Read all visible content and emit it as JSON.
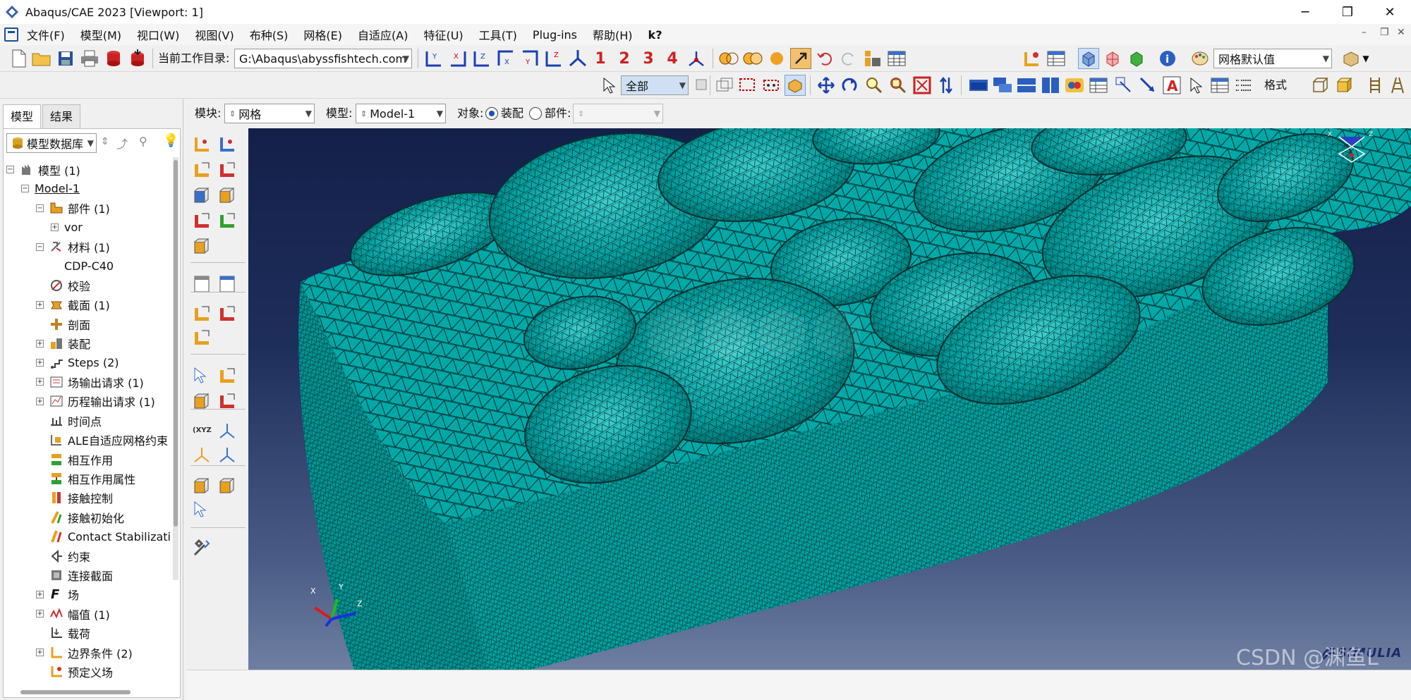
{
  "window": {
    "title": "Abaqus/CAE 2023 [Viewport: 1]",
    "min": "─",
    "max": "❐",
    "close": "✕"
  },
  "menubar": {
    "items": [
      "文件(F)",
      "模型(M)",
      "视口(W)",
      "视图(V)",
      "布种(S)",
      "网格(E)",
      "自适应(A)",
      "特征(U)",
      "工具(T)",
      "Plug-ins",
      "帮助(H)",
      "k?"
    ],
    "mdi": [
      "–",
      "❐",
      "✕"
    ]
  },
  "toolbar1": {
    "workdir_label": "当前工作目录:",
    "workdir_value": "G:\\Abaqus\\abyssfishtech.com",
    "views": [
      "1",
      "2",
      "3",
      "4"
    ],
    "render_style": "网格默认值"
  },
  "toolbar2": {
    "selection_filter": "全部",
    "format_label": "格式"
  },
  "context": {
    "module_label": "模块:",
    "module_value": "网格",
    "model_label": "模型:",
    "model_value": "Model-1",
    "object_label": "对象:",
    "assembly_label": "装配",
    "part_label": "部件:",
    "part_value": ""
  },
  "tabs": [
    "模型",
    "结果"
  ],
  "tree_combo": "模型数据库",
  "tree": [
    {
      "label": "模型 (1)",
      "level": 0,
      "exp": "⊟",
      "icon": "models-icon"
    },
    {
      "label": "Model-1",
      "level": 1,
      "exp": "⊟",
      "icon": ""
    },
    {
      "label": "部件 (1)",
      "level": 2,
      "exp": "⊟",
      "icon": "parts-icon"
    },
    {
      "label": "vor",
      "level": 3,
      "exp": "⊞",
      "icon": ""
    },
    {
      "label": "材料 (1)",
      "level": 2,
      "exp": "⊟",
      "icon": "materials-icon"
    },
    {
      "label": "CDP-C40",
      "level": 3,
      "exp": "",
      "icon": ""
    },
    {
      "label": "校验",
      "level": 2,
      "exp": "",
      "icon": "calibration-icon"
    },
    {
      "label": "截面 (1)",
      "level": 2,
      "exp": "⊞",
      "icon": "sections-icon"
    },
    {
      "label": "剖面",
      "level": 2,
      "exp": "",
      "icon": "profiles-icon"
    },
    {
      "label": "装配",
      "level": 2,
      "exp": "⊞",
      "icon": "assembly-icon"
    },
    {
      "label": "Steps (2)",
      "level": 2,
      "exp": "⊞",
      "icon": "steps-icon"
    },
    {
      "label": "场输出请求 (1)",
      "level": 2,
      "exp": "⊞",
      "icon": "field-output-icon"
    },
    {
      "label": "历程输出请求 (1)",
      "level": 2,
      "exp": "⊞",
      "icon": "history-output-icon"
    },
    {
      "label": "时间点",
      "level": 2,
      "exp": "",
      "icon": "time-points-icon"
    },
    {
      "label": "ALE自适应网格约束",
      "level": 2,
      "exp": "",
      "icon": "ale-icon"
    },
    {
      "label": "相互作用",
      "level": 2,
      "exp": "",
      "icon": "interaction-icon"
    },
    {
      "label": "相互作用属性",
      "level": 2,
      "exp": "",
      "icon": "interaction-property-icon"
    },
    {
      "label": "接触控制",
      "level": 2,
      "exp": "",
      "icon": "contact-control-icon"
    },
    {
      "label": "接触初始化",
      "level": 2,
      "exp": "",
      "icon": "contact-init-icon"
    },
    {
      "label": "Contact Stabilizati",
      "level": 2,
      "exp": "",
      "icon": "contact-stabilization-icon"
    },
    {
      "label": "约束",
      "level": 2,
      "exp": "",
      "icon": "constraint-icon"
    },
    {
      "label": "连接截面",
      "level": 2,
      "exp": "",
      "icon": "connector-section-icon"
    },
    {
      "label": "场",
      "level": 2,
      "exp": "⊞",
      "icon": "field-icon"
    },
    {
      "label": "幅值 (1)",
      "level": 2,
      "exp": "⊞",
      "icon": "amplitude-icon"
    },
    {
      "label": "载荷",
      "level": 2,
      "exp": "",
      "icon": "load-icon"
    },
    {
      "label": "边界条件 (2)",
      "level": 2,
      "exp": "⊞",
      "icon": "bc-icon"
    },
    {
      "label": "预定义场",
      "level": 2,
      "exp": "",
      "icon": "predefined-field-icon"
    }
  ],
  "viewport": {
    "triad_labels": [
      "X",
      "Y",
      "Z"
    ],
    "mini_triad": [
      "X",
      "Y",
      "Z"
    ],
    "logo": "SIMULIA",
    "watermark": "CSDN @渊鱼L",
    "mesh_color": "#00a8a8",
    "line_color": "#0a2a2a"
  }
}
